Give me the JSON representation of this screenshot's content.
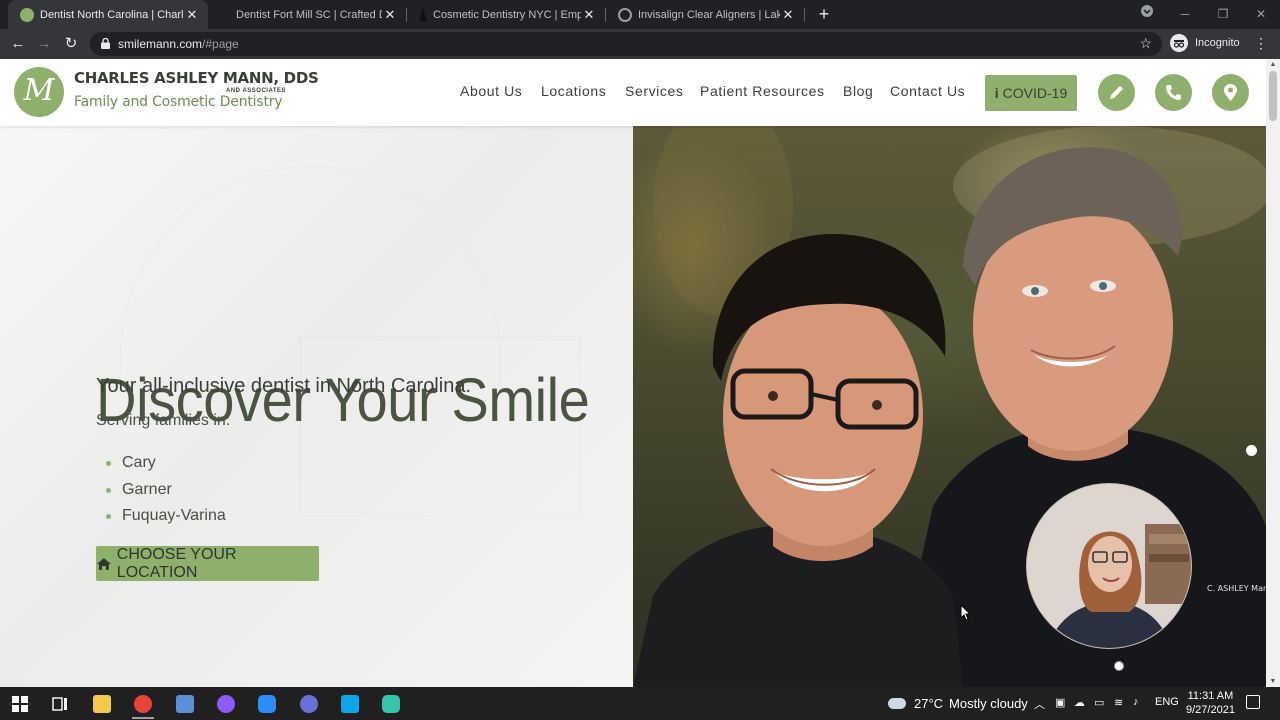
{
  "browser": {
    "tabs": [
      {
        "title": "Dentist North Carolina | Charles A",
        "active": true,
        "favicon_color": "#8eb06c"
      },
      {
        "title": "Dentist Fort Mill SC | Crafted Den",
        "active": false,
        "favicon_color": "#202124"
      },
      {
        "title": "Cosmetic Dentistry NYC | Empire",
        "active": false,
        "favicon_color": "#111111"
      },
      {
        "title": "Invisalign Clear Aligners | Lake Bl",
        "active": false,
        "favicon_color": "#9aa0a6"
      }
    ],
    "new_tab_label": "+",
    "url_host": "smilemann.com",
    "url_path": "/#page",
    "profile_label": "Incognito"
  },
  "site": {
    "logo": {
      "monogram": "M",
      "name": "CHARLES ASHLEY MANN, DDS",
      "associates": "AND ASSOCIATES",
      "tagline": "Family and Cosmetic Dentistry"
    },
    "nav": {
      "items": [
        "About Us",
        "Locations",
        "Services",
        "Patient Resources",
        "Blog",
        "Contact Us"
      ],
      "covid_label": "COVID-19"
    },
    "hero": {
      "title": "Discover Your Smile",
      "subtitle": "Your all-inclusive dentist in North Carolina.",
      "serving_label": "Serving families in:",
      "cities": [
        "Cary",
        "Garner",
        "Fuquay-Varina"
      ],
      "cta_label": "CHOOSE YOUR LOCATION",
      "photo_watermark": "C. ASHLEY Mann"
    },
    "colors": {
      "accent": "#8eb06c",
      "heading": "#4a5440",
      "text": "#3a3f38"
    }
  },
  "taskbar": {
    "weather_temp": "27°C",
    "weather_desc": "Mostly cloudy",
    "language": "ENG",
    "time": "11:31 AM",
    "date": "9/27/2021"
  }
}
